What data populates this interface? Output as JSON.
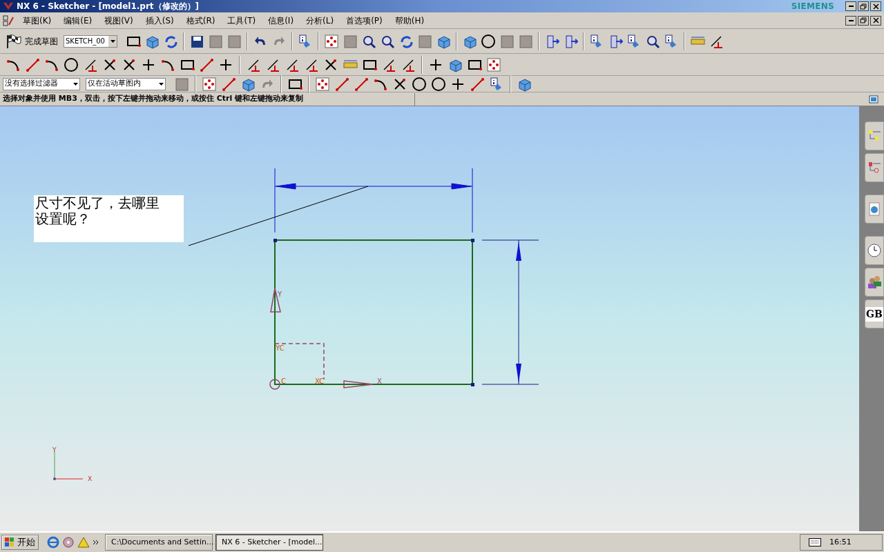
{
  "window": {
    "title": "NX 6 - Sketcher - [model1.prt（修改的）]",
    "brand": "SIEMENS"
  },
  "menu": [
    {
      "label": "草图(K)"
    },
    {
      "label": "编辑(E)"
    },
    {
      "label": "视图(V)"
    },
    {
      "label": "插入(S)"
    },
    {
      "label": "格式(R)"
    },
    {
      "label": "工具(T)"
    },
    {
      "label": "信息(I)"
    },
    {
      "label": "分析(L)"
    },
    {
      "label": "首选项(P)"
    },
    {
      "label": "帮助(H)"
    }
  ],
  "toolbar": {
    "finish_sketch": "完成草图",
    "sketch_name": "SKETCH_00"
  },
  "filters": [
    {
      "value": "没有选择过滤器"
    },
    {
      "value": "仅在活动草图内"
    }
  ],
  "cue_line": "选择对象并使用 MB3，双击，按下左键并拖动来移动，或按住 Ctrl 键和左键拖动来复制",
  "canvas": {
    "note": "尺寸不见了，去哪里设置呢？",
    "labels": [
      "Y",
      "YC",
      "C",
      "XC",
      "X"
    ],
    "triad": [
      "Y",
      "X"
    ]
  },
  "resource_bar": {
    "last_tab": "GB"
  },
  "taskbar": {
    "start": "开始",
    "tasks": [
      {
        "label": "C:\\Documents and Settin...",
        "selected": false
      },
      {
        "label": "NX 6 - Sketcher - [model...",
        "selected": true
      }
    ],
    "clock": "16:51"
  }
}
